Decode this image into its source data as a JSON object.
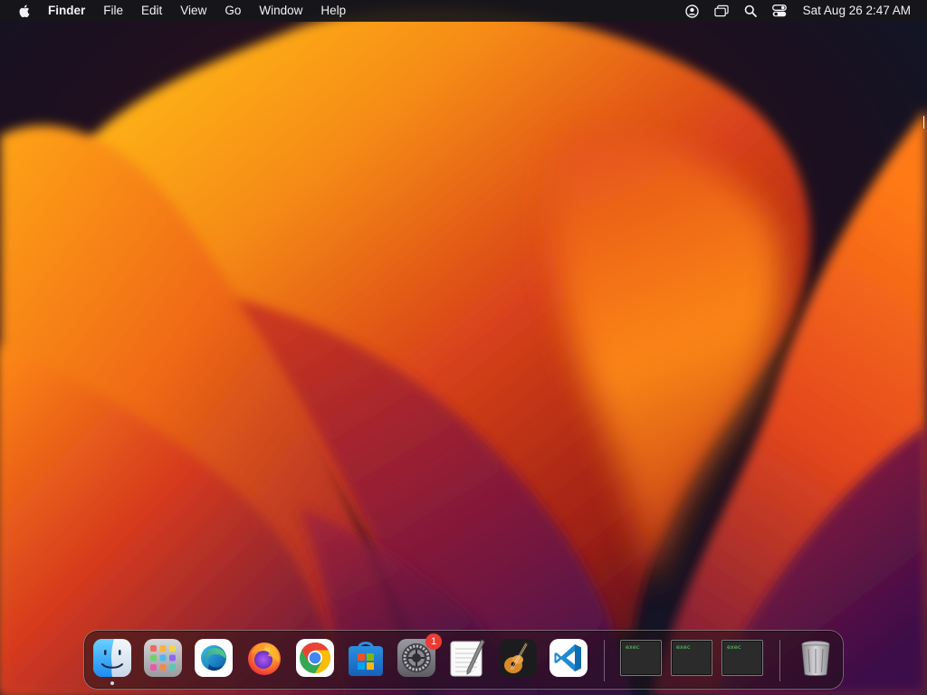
{
  "menubar": {
    "app_name": "Finder",
    "menus": [
      "File",
      "Edit",
      "View",
      "Go",
      "Window",
      "Help"
    ],
    "status_icons": [
      "user-account-icon",
      "screen-mirroring-icon",
      "spotlight-search-icon",
      "control-center-icon"
    ],
    "clock": "Sat Aug 26  2:47 AM"
  },
  "dock": {
    "apps": [
      {
        "name": "Finder",
        "icon": "finder-icon",
        "running": true
      },
      {
        "name": "Launchpad",
        "icon": "launchpad-icon",
        "running": false
      },
      {
        "name": "Microsoft Edge",
        "icon": "edge-icon",
        "running": false
      },
      {
        "name": "Firefox",
        "icon": "firefox-icon",
        "running": false
      },
      {
        "name": "Google Chrome",
        "icon": "chrome-icon",
        "running": false
      },
      {
        "name": "Microsoft Store",
        "icon": "store-icon",
        "running": false
      },
      {
        "name": "System Settings",
        "icon": "system-settings-icon",
        "running": false,
        "badge": "1"
      },
      {
        "name": "TextEdit",
        "icon": "textedit-icon",
        "running": false
      },
      {
        "name": "GarageBand",
        "icon": "garageband-icon",
        "running": false
      },
      {
        "name": "Visual Studio Code",
        "icon": "vscode-icon",
        "running": false
      }
    ],
    "minimized_windows": [
      {
        "label": "exec"
      },
      {
        "label": "exec"
      },
      {
        "label": "exec"
      }
    ],
    "trash": {
      "name": "Trash",
      "icon": "trash-icon"
    }
  },
  "colors": {
    "menubar_bg": "#16161a",
    "wallpaper_orange": "#f28a1a",
    "wallpaper_red": "#c8321c",
    "wallpaper_dark": "#0b1a2b",
    "badge_red": "#ee3a33"
  }
}
